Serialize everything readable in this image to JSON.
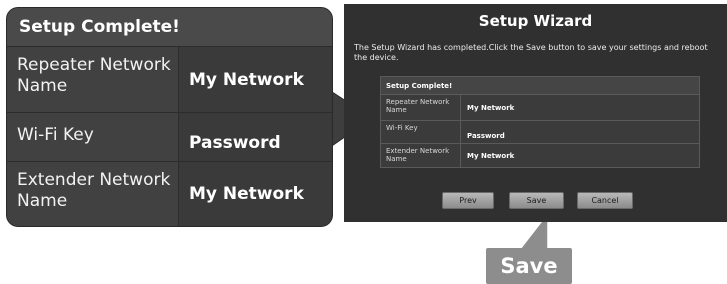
{
  "callout": {
    "title": "Setup Complete!",
    "rows": [
      {
        "label": "Repeater Network Name",
        "value": "My Network"
      },
      {
        "label": "Wi-Fi Key",
        "value": "Password"
      },
      {
        "label": "Extender Network Name",
        "value": "My Network"
      }
    ]
  },
  "wizard": {
    "title": "Setup Wizard",
    "description": "The Setup Wizard has completed.Click the Save button to save your settings and reboot the device.",
    "table": {
      "header": "Setup Complete!",
      "rows": [
        {
          "label": "Repeater Network Name",
          "value": "My Network"
        },
        {
          "label": "Wi-Fi Key",
          "value": "Password"
        },
        {
          "label": "Extender Network Name",
          "value": "My Network"
        }
      ]
    },
    "buttons": {
      "prev": "Prev",
      "save": "Save",
      "cancel": "Cancel"
    }
  },
  "save_callout": {
    "label": "Save"
  },
  "colors": {
    "panel_dark": "#3e3e3e",
    "wizard_bg": "#303030",
    "button": "#a6a6a6",
    "callout_pointer": "#8d8d8d"
  }
}
